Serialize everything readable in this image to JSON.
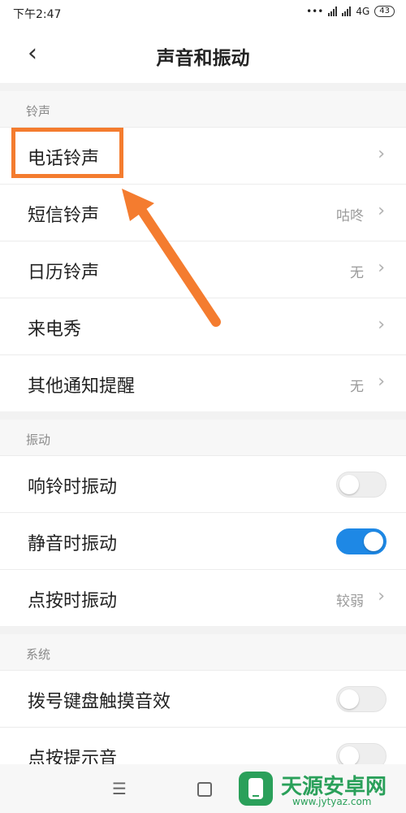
{
  "status": {
    "time": "下午2:47",
    "net": "4G",
    "battery": "43"
  },
  "header": {
    "back_icon": "chevron-left-icon",
    "title": "声音和振动"
  },
  "sections": [
    {
      "title": "铃声",
      "items": [
        {
          "label": "电话铃声",
          "value": ""
        },
        {
          "label": "短信铃声",
          "value": "咕咚"
        },
        {
          "label": "日历铃声",
          "value": "无"
        },
        {
          "label": "来电秀",
          "value": ""
        },
        {
          "label": "其他通知提醒",
          "value": "无"
        }
      ]
    },
    {
      "title": "振动",
      "items": [
        {
          "label": "响铃时振动",
          "toggle": false
        },
        {
          "label": "静音时振动",
          "toggle": true
        },
        {
          "label": "点按时振动",
          "value": "较弱"
        }
      ]
    },
    {
      "title": "系统",
      "items": [
        {
          "label": "拨号键盘触摸音效",
          "toggle": false
        },
        {
          "label": "点按提示音",
          "toggle": false
        }
      ]
    }
  ],
  "annotation": {
    "highlight_color": "#f47c2f",
    "points_to": "电话铃声"
  },
  "colors": {
    "toggle_on": "#1e88e5",
    "accent_orange": "#f47c2f"
  },
  "watermark": {
    "name": "天源安卓网",
    "url": "www.jytyaz.com"
  }
}
